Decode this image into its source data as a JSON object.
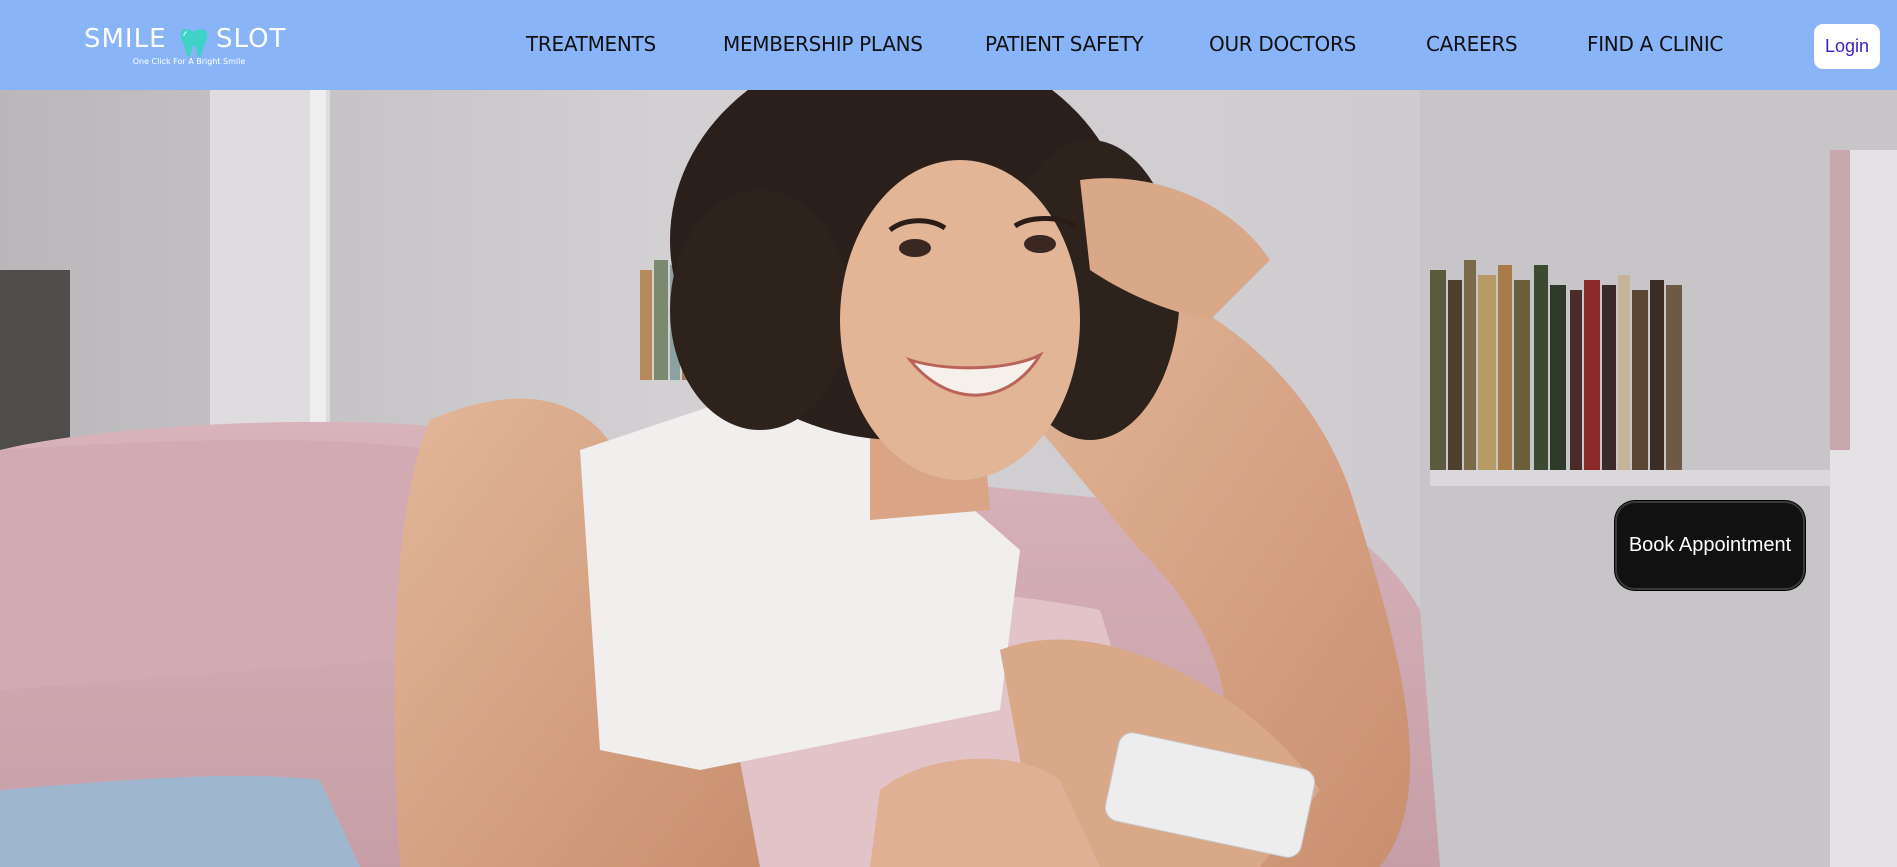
{
  "brand": {
    "name_part1": "SMILE",
    "name_part2": "SLOT",
    "tagline": "One Click For A Bright Smile",
    "logo_icon": "tooth-icon",
    "logo_icon_color": "#3fd2c7"
  },
  "nav": {
    "items": [
      {
        "label": "TREATMENTS"
      },
      {
        "label": "MEMBERSHIP PLANS"
      },
      {
        "label": "PATIENT SAFETY"
      },
      {
        "label": "OUR DOCTORS"
      },
      {
        "label": "CAREERS"
      },
      {
        "label": "FIND A CLINIC"
      }
    ],
    "login_label": "Login"
  },
  "hero": {
    "image_description_icon": "hero-photo",
    "cta_label": "Book Appointment"
  },
  "colors": {
    "header_bg": "#8ab4f8",
    "login_text": "#3b1fbf",
    "cta_bg": "#111111"
  }
}
